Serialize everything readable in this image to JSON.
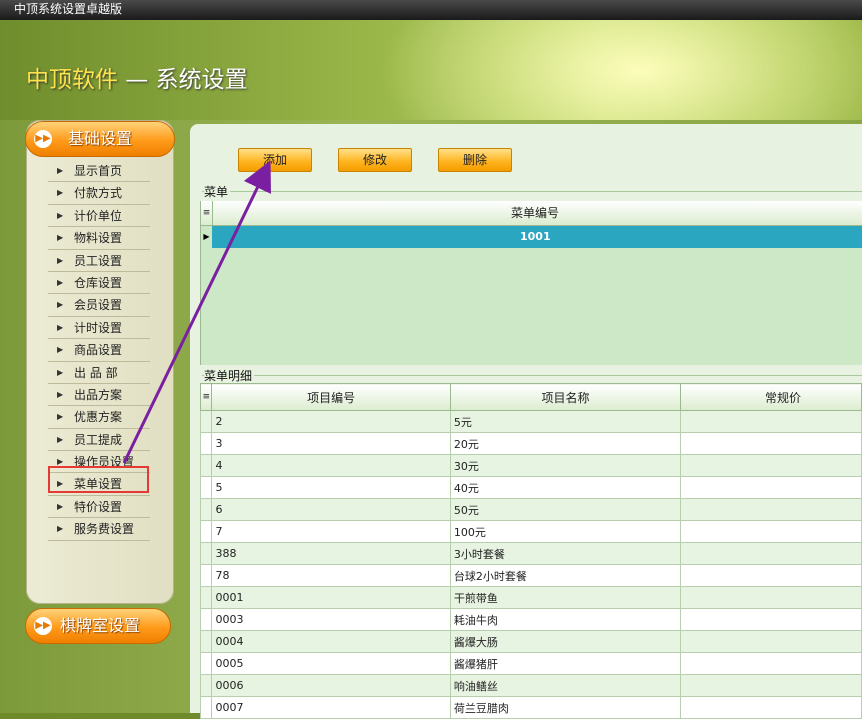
{
  "window": {
    "title": "中顶系统设置卓越版"
  },
  "header": {
    "brand": "中顶软件",
    "dash": " — ",
    "page": "系统设置"
  },
  "sidebar": {
    "section_basic": "基础设置",
    "section_chess": "棋牌室设置",
    "items": [
      {
        "label": "显示首页"
      },
      {
        "label": "付款方式"
      },
      {
        "label": "计价单位"
      },
      {
        "label": "物料设置"
      },
      {
        "label": "员工设置"
      },
      {
        "label": "仓库设置"
      },
      {
        "label": "会员设置"
      },
      {
        "label": "计时设置"
      },
      {
        "label": "商品设置"
      },
      {
        "label": "出 品 部"
      },
      {
        "label": "出品方案"
      },
      {
        "label": "优惠方案"
      },
      {
        "label": "员工提成"
      },
      {
        "label": "操作员设置"
      },
      {
        "label": "菜单设置"
      },
      {
        "label": "特价设置"
      },
      {
        "label": "服务费设置"
      }
    ],
    "selected_item": "菜单设置"
  },
  "toolbar": {
    "add": "添加",
    "edit": "修改",
    "delete": "删除"
  },
  "menu_group": {
    "label": "菜单",
    "column": "菜单编号",
    "selected_row": "1001"
  },
  "detail_group": {
    "label": "菜单明细",
    "columns": [
      "项目编号",
      "项目名称",
      "常规价"
    ],
    "rows": [
      {
        "code": "2",
        "name": "5元"
      },
      {
        "code": "3",
        "name": "20元"
      },
      {
        "code": "4",
        "name": "30元"
      },
      {
        "code": "5",
        "name": "40元"
      },
      {
        "code": "6",
        "name": "50元"
      },
      {
        "code": "7",
        "name": "100元"
      },
      {
        "code": "388",
        "name": "3小时套餐"
      },
      {
        "code": "78",
        "name": "台球2小时套餐"
      },
      {
        "code": "0001",
        "name": "干煎带鱼"
      },
      {
        "code": "0003",
        "name": "耗油牛肉"
      },
      {
        "code": "0004",
        "name": "酱爆大肠"
      },
      {
        "code": "0005",
        "name": "酱爆猪肝"
      },
      {
        "code": "0006",
        "name": "响油鳝丝"
      },
      {
        "code": "0007",
        "name": "荷兰豆腊肉"
      }
    ]
  },
  "colors": {
    "accent_orange": "#ff9a1a",
    "selected_row": "#2aa6c0",
    "annotation_arrow": "#7b1fa2",
    "highlight_box": "#e53935"
  }
}
